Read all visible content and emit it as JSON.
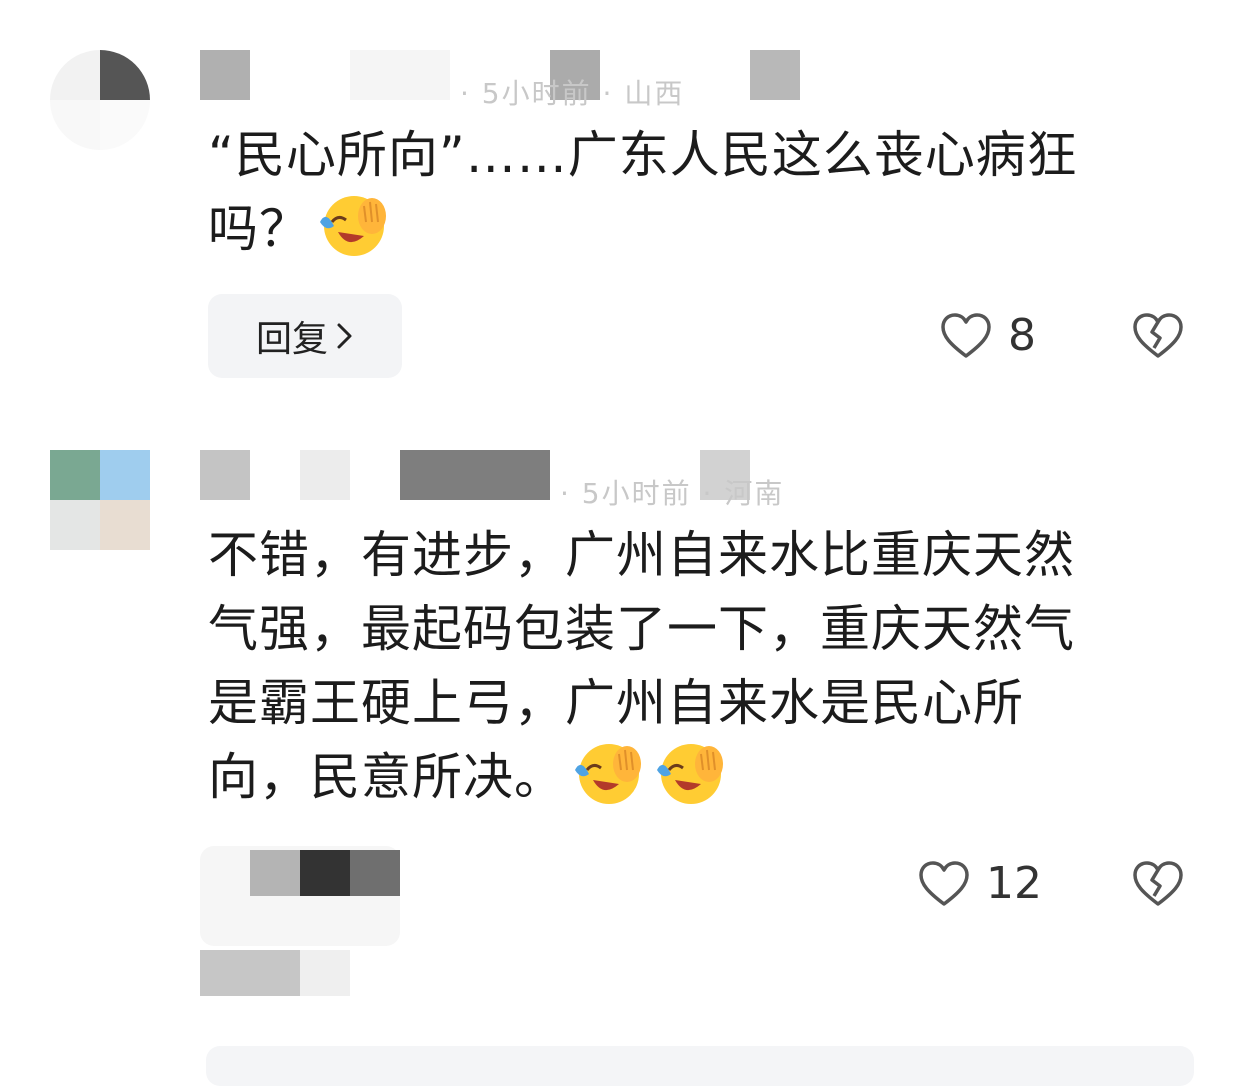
{
  "comments": [
    {
      "text_lines": [
        "“民心所向”……广东人民这么丧心病狂",
        "吗？"
      ],
      "emoji": "laughing-crying-emoji",
      "reply_label": "回复",
      "likes": "8",
      "meta_ghost": "· 5小时前 · 山西"
    },
    {
      "text_lines": [
        "不错，有进步，广州自来水比重庆天然",
        "气强，最起码包装了一下，重庆天然气",
        "是霸王硬上弓，广州自来水是民心所",
        "向，民意所决。"
      ],
      "emoji": "laughing-crying-emoji",
      "likes": "12",
      "meta_ghost": "· 5小时前 · 河南"
    }
  ],
  "colors": {
    "reply_bg": "#f3f4f6",
    "icon_stroke": "#555555",
    "text": "#1c1c1c"
  },
  "icons": [
    "heart-icon",
    "broken-heart-icon",
    "chevron-right-icon"
  ]
}
